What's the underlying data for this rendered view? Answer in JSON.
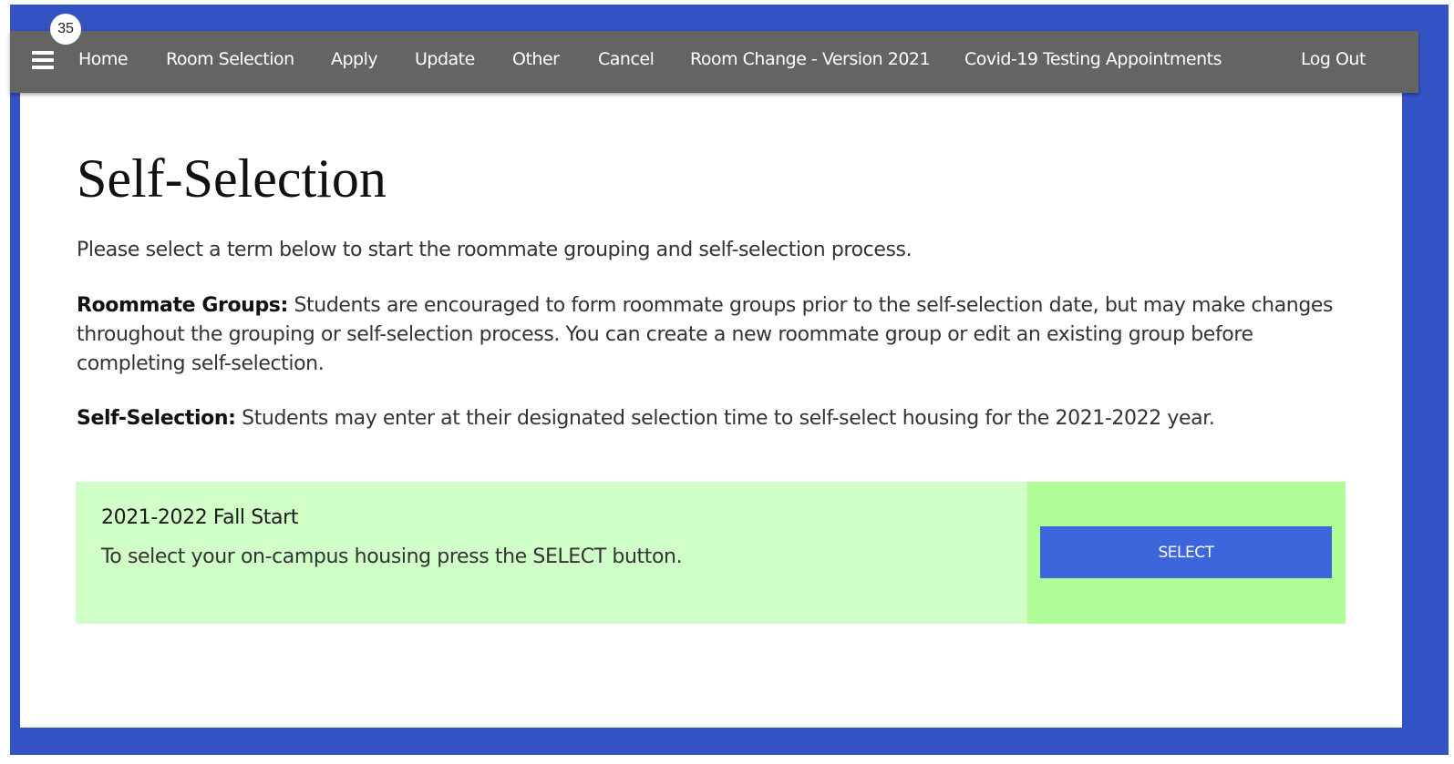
{
  "nav": {
    "badge_count": "35",
    "items": [
      {
        "label": "Home"
      },
      {
        "label": "Room Selection"
      },
      {
        "label": "Apply"
      },
      {
        "label": "Update"
      },
      {
        "label": "Other"
      },
      {
        "label": "Cancel"
      },
      {
        "label": "Room Change - Version 2021"
      },
      {
        "label": "Covid-19 Testing Appointments"
      }
    ],
    "logout_label": "Log Out"
  },
  "page": {
    "title": "Self-Selection",
    "intro": "Please select a term below to start the roommate grouping and self-selection process.",
    "roommate_groups_label": "Roommate Groups:",
    "roommate_groups_text": " Students are encouraged to form roommate groups prior to the self-selection date, but may make changes throughout the grouping or self-selection process. You can create a new roommate group or edit an existing group before completing self-selection.",
    "self_selection_label": "Self-Selection:",
    "self_selection_text": " Students may enter at their designated selection time to self-select housing for the 2021-2022 year."
  },
  "term": {
    "title": "2021-2022 Fall Start",
    "description": "To select your on-campus housing press the SELECT button.",
    "button_label": "SELECT"
  },
  "colors": {
    "frame": "#3352c4",
    "navbar": "#646464",
    "card_left": "#d0ffc8",
    "card_right": "#b0fc98",
    "button": "#3d65dc"
  }
}
